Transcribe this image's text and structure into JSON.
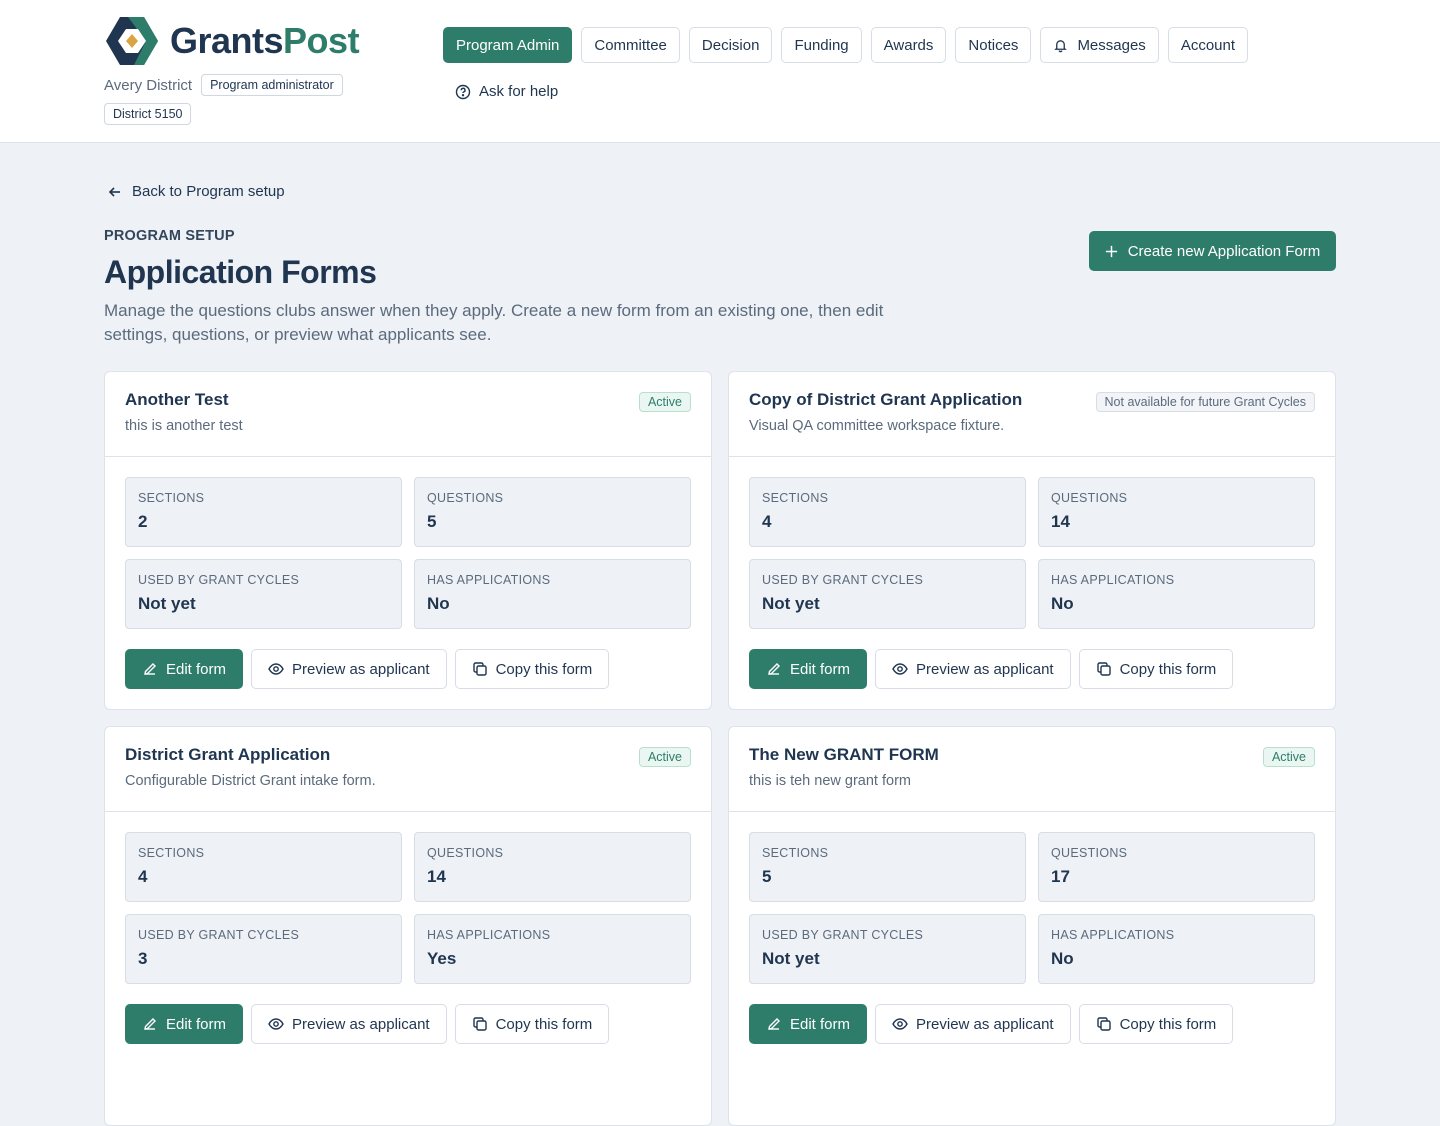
{
  "brand": {
    "name_part1": "Grants",
    "name_part2": "Post"
  },
  "org": {
    "name": "Avery District",
    "role": "Program administrator",
    "district": "District 5150"
  },
  "nav": {
    "items": [
      "Program Admin",
      "Committee",
      "Decision",
      "Funding",
      "Awards",
      "Notices",
      "Messages",
      "Account"
    ],
    "active": "Program Admin",
    "help": "Ask for help"
  },
  "page": {
    "back_link": "Back to Program setup",
    "eyebrow": "PROGRAM SETUP",
    "title": "Application Forms",
    "description": "Manage the questions clubs answer when they apply. Create a new form from an existing one, then edit settings, questions, or preview what applicants see.",
    "create_button": "Create new Application Form"
  },
  "stat_labels": {
    "sections": "SECTIONS",
    "questions": "QUESTIONS",
    "used_by": "USED BY GRANT CYCLES",
    "has_apps": "HAS APPLICATIONS"
  },
  "actions": {
    "edit": "Edit form",
    "preview": "Preview as applicant",
    "copy": "Copy this form"
  },
  "forms": [
    {
      "title": "Another Test",
      "subtitle": "this is another test",
      "status": "Active",
      "status_type": "active",
      "sections": "2",
      "questions": "5",
      "used_by": "Not yet",
      "has_apps": "No"
    },
    {
      "title": "Copy of District Grant Application",
      "subtitle": "Visual QA committee workspace fixture.",
      "status": "Not available for future Grant Cycles",
      "status_type": "inactive",
      "sections": "4",
      "questions": "14",
      "used_by": "Not yet",
      "has_apps": "No"
    },
    {
      "title": "District Grant Application",
      "subtitle": "Configurable District Grant intake form.",
      "status": "Active",
      "status_type": "active",
      "sections": "4",
      "questions": "14",
      "used_by": "3",
      "has_apps": "Yes"
    },
    {
      "title": "The New GRANT FORM",
      "subtitle": "this is teh new grant form",
      "status": "Active",
      "status_type": "active",
      "sections": "5",
      "questions": "17",
      "used_by": "Not yet",
      "has_apps": "No"
    }
  ],
  "colors": {
    "brand_green": "#2e7d6b",
    "navy": "#1f3550",
    "muted": "#5b6b7d",
    "bg": "#eef1f5"
  }
}
